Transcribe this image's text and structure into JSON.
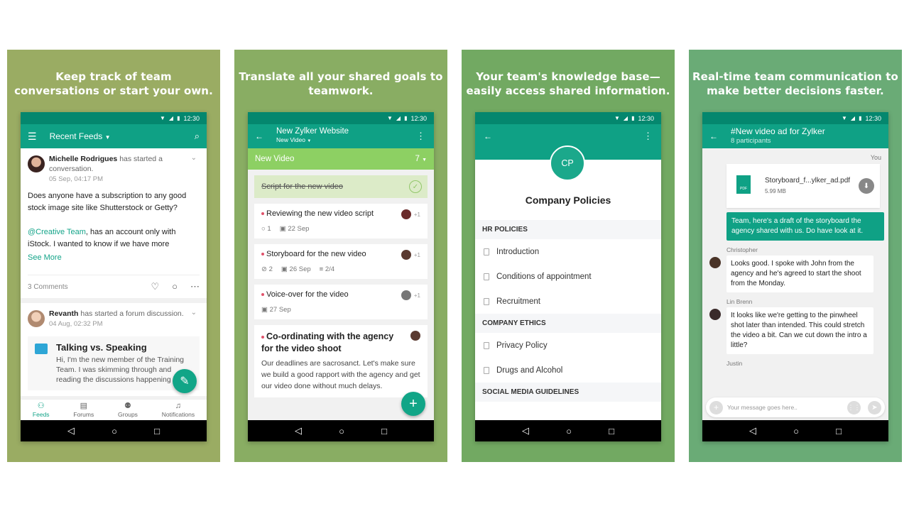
{
  "status_bar": {
    "time": "12:30",
    "icons": [
      "wifi-icon",
      "signal-icon",
      "battery-icon"
    ]
  },
  "panels": [
    {
      "tagline": [
        "Keep track of team",
        "conversations or start your own."
      ],
      "appbar": {
        "title": "Recent Feeds"
      },
      "posts": [
        {
          "author": "Michelle Rodrigues",
          "action": "has started a conversation.",
          "time": "05 Sep, 04:17 PM",
          "body_line1": "Does anyone have a subscription to any good stock image site like Shutterstock or Getty?",
          "mention": "@Creative Team",
          "body_line2": ", has an account only with iStock. I wanted to know if we have more",
          "see_more": "See More",
          "comments": "3 Comments"
        },
        {
          "author": "Revanth",
          "action": "has started a forum discussion.",
          "time": "04 Aug, 02:32 PM",
          "forum_title": "Talking vs. Speaking",
          "forum_text": "Hi, I'm the new member of the Training Team. I was skimming through and reading the discussions happening here."
        }
      ],
      "tabs": [
        {
          "label": "Feeds",
          "icon": "feeds-icon",
          "active": true
        },
        {
          "label": "Forums",
          "icon": "forums-icon",
          "active": false
        },
        {
          "label": "Groups",
          "icon": "groups-icon",
          "active": false
        },
        {
          "label": "Notifications",
          "icon": "bell-icon",
          "active": false
        }
      ]
    },
    {
      "tagline": [
        "Translate all your shared goals to",
        "teamwork."
      ],
      "appbar": {
        "title": "New Zylker Website",
        "subtitle": "New Video"
      },
      "group": {
        "name": "New Video",
        "count": "7"
      },
      "tasks": [
        {
          "title": "Script for the new video",
          "done": true
        },
        {
          "title": "Reviewing the new video script",
          "extra": "+1",
          "comments": "1",
          "date": "22 Sep"
        },
        {
          "title": "Storyboard for the new video",
          "extra": "+1",
          "attachments": "2",
          "date": "26 Sep",
          "checklist": "2/4"
        },
        {
          "title": "Voice-over for the video",
          "extra": "+1",
          "date": "27 Sep"
        },
        {
          "title": "Co-ordinating with the agency for the video shoot",
          "desc": "Our deadlines are sacrosanct. Let's make sure we build a good rapport with the agency and get our video done without much delays."
        }
      ]
    },
    {
      "tagline": [
        "Your team's knowledge base—",
        "easily access shared information."
      ],
      "initials": "CP",
      "title": "Company Policies",
      "sections": [
        {
          "name": "HR POLICIES",
          "items": [
            "Introduction",
            "Conditions of appointment",
            "Recruitment"
          ]
        },
        {
          "name": "COMPANY ETHICS",
          "items": [
            "Privacy Policy",
            "Drugs and Alcohol"
          ]
        },
        {
          "name": "SOCIAL MEDIA GUIDELINES",
          "items": []
        }
      ]
    },
    {
      "tagline": [
        "Real-time team communication to",
        "make better decisions faster."
      ],
      "appbar": {
        "title": "#New video ad for Zylker",
        "subtitle": "8 participants"
      },
      "you_label": "You",
      "file": {
        "name": "Storyboard_f...ylker_ad.pdf",
        "size": "5.99 MB",
        "type": "PDF"
      },
      "my_message": "Team, here's a draft of the storyboard the agency shared with us. Do have look at it.",
      "messages": [
        {
          "sender": "Christopher",
          "text": "Looks good. I spoke with John from the agency and he's agreed to start the shoot from the Monday."
        },
        {
          "sender": "Lin Brenn",
          "text": "It looks like we're getting to the pinwheel shot later than intended. This could stretch the video a bit. Can we cut down the intro a little?"
        },
        {
          "sender": "Justin",
          "text": ""
        }
      ],
      "composer_placeholder": "Your message goes here.."
    }
  ],
  "colors": {
    "teal": "#0fa185",
    "teal_dark": "#04876e",
    "group_green": "#8dd063",
    "accent_text": "#14a489"
  }
}
